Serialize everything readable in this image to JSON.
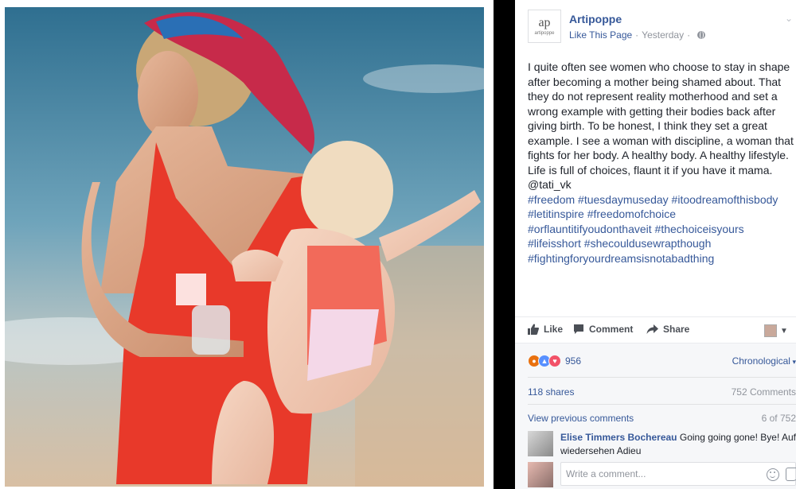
{
  "post": {
    "page_name": "Artipoppe",
    "logo_mark": "ap",
    "logo_word": "artipoppe",
    "like_page": "Like This Page",
    "separator": "·",
    "timestamp": "Yesterday",
    "text": "I quite often see women who choose to stay in shape after becoming a mother being shamed about. That they do not represent reality motherhood and set a wrong example with getting their bodies back after giving birth. To be honest, I think they set a great example. I see a woman with discipline, a woman that fights for her body. A healthy body. A healthy lifestyle. Life is full of choices, flaunt it if you have it mama. @tati_vk",
    "hashtags": [
      "#freedom #tuesdaymuseday #itoodreamofthisbody",
      "#letitinspire #freedomofchoice",
      "#orflauntitifyoudonthaveit #thechoiceisyours",
      "#lifeisshort #shecouldusewrapthough",
      "#fightingforyourdreamsisnotabadthing"
    ]
  },
  "actions": {
    "like": "Like",
    "comment": "Comment",
    "share": "Share"
  },
  "stats": {
    "reactions": "956",
    "sort": "Chronological",
    "shares": "118 shares",
    "comments": "752 Comments",
    "view_previous": "View previous comments",
    "page_counter": "6 of 752"
  },
  "comment": {
    "author": "Elise Timmers Bochereau",
    "text": "Going going gone! Bye! Auf wiedersehen Adieu"
  },
  "composer": {
    "placeholder": "Write a comment..."
  },
  "colors": {
    "link": "#365899",
    "text": "#1d2129",
    "muted": "#90949c",
    "swimsuit": "#e8392a"
  }
}
